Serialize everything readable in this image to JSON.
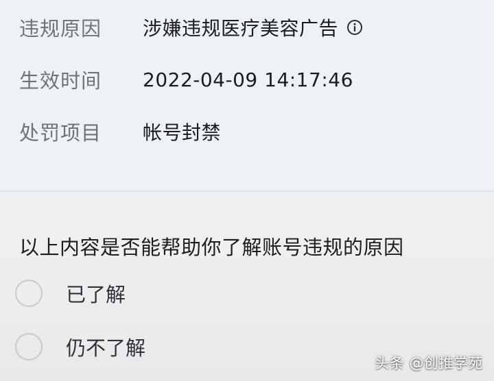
{
  "violation_info": {
    "reason_label": "违规原因",
    "reason_value": "涉嫌违规医疗美容广告",
    "effective_time_label": "生效时间",
    "effective_time_value": "2022-04-09 14:17:46",
    "penalty_label": "处罚项目",
    "penalty_value": "帐号封禁",
    "info_icon": "info-circle-icon"
  },
  "survey": {
    "question": "以上内容是否能帮助你了解账号违规的原因",
    "options": [
      {
        "label": "已了解"
      },
      {
        "label": "仍不了解"
      }
    ]
  },
  "watermark": "头条 @创推学苑",
  "colors": {
    "label_text": "#6f7377",
    "value_text": "#1a1c1f",
    "radio_border": "#c7c9cc",
    "background": "#eff2f4"
  }
}
